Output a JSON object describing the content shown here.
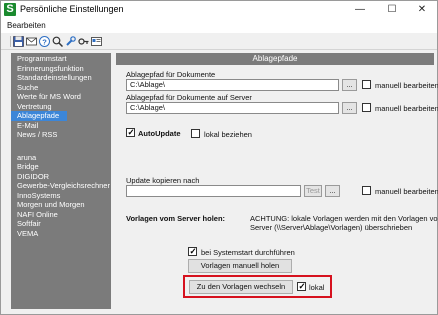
{
  "window": {
    "title": "Persönliche Einstellungen",
    "logo_letter": "S",
    "controls": {
      "minimize": "—",
      "maximize": "☐",
      "close": "✕"
    }
  },
  "menu": {
    "edit": "Bearbeiten"
  },
  "toolbar": {
    "icons": [
      "save-icon",
      "mail-icon",
      "help-icon",
      "search-icon",
      "wrench-icon",
      "key-icon",
      "card-icon"
    ]
  },
  "sidebar": {
    "items": [
      "Programmstart",
      "Erinnerungsfunktion",
      "Standardeinstellungen",
      "Suche",
      "Werte für MS Word",
      "Vertretung",
      "Ablagepfade",
      "E-Mail",
      "News / RSS"
    ],
    "active_item": "Ablagepfade",
    "items2": [
      "aruna",
      "Bridge",
      "DIGIDOR",
      "Gewerbe-Vergleichsrechner",
      "InnoSystems",
      "Morgen und Morgen",
      "NAFI Online",
      "Softfair",
      "VEMA"
    ]
  },
  "content": {
    "header": "Ablagepfade",
    "doc_path_label": "Ablagepfad für Dokumente",
    "doc_path_value": "C:\\Ablage\\",
    "server_path_label": "Ablagepfad für Dokumente auf Server",
    "server_path_value": "C:\\Ablage\\",
    "browse_label": "...",
    "manual_edit_label": "manuell bearbeiten",
    "autoupdate_label": "AutoUpdate",
    "local_fetch_label": "lokal beziehen",
    "update_copy_label": "Update kopieren nach",
    "update_copy_value": "",
    "test_label": "Test",
    "fetch_server_label": "Vorlagen vom Server holen:",
    "warning_text_line1": "ACHTUNG: lokale Vorlagen werden mit den Vorlagen vom",
    "warning_text_line2": "Server (\\\\Server\\Ablage\\Vorlagen) überschrieben",
    "on_start_label": "bei Systemstart durchführen",
    "fetch_manual_button": "Vorlagen manuell holen",
    "switch_templates_button": "Zu den Vorlagen wechseln",
    "local_label": "lokal"
  },
  "colors": {
    "sidebar_bg": "#7b7b7b",
    "active_item_bg": "#3c86d8",
    "highlight_border": "#d6111e",
    "logo_green": "#1a8a2e"
  }
}
